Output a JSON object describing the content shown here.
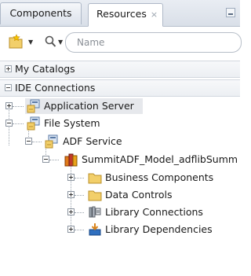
{
  "tabs": {
    "components": "Components",
    "resources": "Resources",
    "close_glyph": "×"
  },
  "toolbar": {
    "search_placeholder": "Name"
  },
  "sections": {
    "my_catalogs": "My Catalogs",
    "ide_connections": "IDE Connections"
  },
  "tree": {
    "application_server": "Application Server",
    "file_system": "File System",
    "adf_service": "ADF Service",
    "library_item": "SummitADF_Model_adflibSumm",
    "business_components": "Business Components",
    "data_controls": "Data Controls",
    "library_connections": "Library Connections",
    "library_dependencies": "Library Dependencies"
  },
  "icons": {
    "new": "new-icon",
    "search": "search-icon",
    "server": "server-connection-icon",
    "folder": "folder-icon",
    "library": "library-icon",
    "connections": "library-connections-icon",
    "dependencies": "library-dependencies-icon"
  },
  "colors": {
    "folder": "#f2cf6a",
    "selection": "#e6e8ec",
    "accent_blue": "#2f6fbf"
  }
}
